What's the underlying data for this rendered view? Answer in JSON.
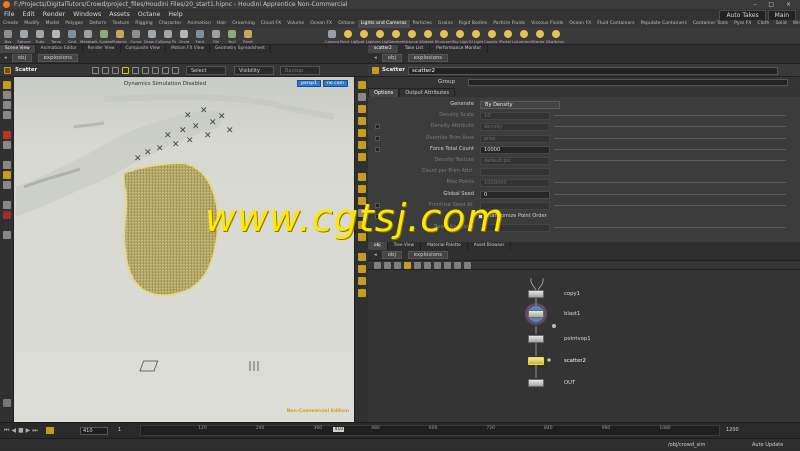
{
  "window": {
    "title": "F:/Projects/DigitalTutors/Crowd/project_files/Houdini Files/20_start1.hipnc - Houdini Apprentice Non-Commercial",
    "controls": "– □ ×"
  },
  "menu": {
    "items": [
      "File",
      "Edit",
      "Render",
      "Windows",
      "Assets",
      "Octane",
      "Help"
    ],
    "desktop": "Auto Takes",
    "desktop_value": "Main"
  },
  "shelf_tabs": [
    "Create",
    "Modify",
    "Model",
    "Polygon",
    "Deform",
    "Texture",
    "Rigging",
    "Character",
    "Animation",
    "Hair",
    "Grooming",
    "Cloud FX",
    "Volume",
    "Ocean FX",
    "Octane",
    "Lights and Cameras",
    "Particles",
    "Grains",
    "Rigid Bodies",
    "Particle Fluids",
    "Viscous Fluids",
    "Ocean FX",
    "Fluid Containers",
    "Populate Containers",
    "Container Tools",
    "Pyro FX",
    "Cloth",
    "Solid",
    "Wires",
    "Crowds",
    "Drive Simulation"
  ],
  "shelf_tools_left": [
    "Box",
    "Sphere",
    "Tube",
    "Torus",
    "Grid",
    "Metaball",
    "L-System",
    "Platonic Sol.",
    "Curve",
    "Draw Curve",
    "Spray Paint",
    "Circle",
    "Font",
    "File",
    "Null",
    "Rivet"
  ],
  "shelf_tools_right": [
    "Camera",
    "Point Light",
    "Spot Light",
    "Area Light",
    "Geometry L.",
    "Volume Light",
    "Distant Light",
    "Environmen.",
    "Sky Light",
    "GI Light",
    "Caustic Light",
    "Portal Light",
    "Ambient Lig.",
    "Stereo Cam.",
    "Switcher"
  ],
  "viewport_tabs": [
    "Scene View",
    "Animation Editor",
    "Render View",
    "Composite View",
    "Motion FX View",
    "Geometry Spreadsheet"
  ],
  "viewport": {
    "path_root": "obj",
    "path_node": "explosions",
    "operation": "Scatter",
    "select_label": "Select",
    "visibility_label": "Visibility",
    "backup_label": "Backup",
    "sim_status": "Dynamics Simulation Disabled",
    "camera": "persp1",
    "cam_mode": "no cam",
    "license": "Non-Commercial Edition"
  },
  "props_tabs": [
    "scatter2",
    "Take List",
    "Performance Monitor"
  ],
  "props": {
    "path_root": "obj",
    "path_node": "explosions",
    "node_type": "Scatter",
    "node_name": "scatter2",
    "group_label": "Group",
    "subtabs": [
      "Options",
      "Output Attributes"
    ],
    "params": [
      {
        "label": "Generate",
        "value": "By Density",
        "kind": "dropdown",
        "enabled": true,
        "checkbox": false
      },
      {
        "label": "Density Scale",
        "value": "10",
        "kind": "field",
        "enabled": false,
        "checkbox": false
      },
      {
        "label": "Density Attribute",
        "value": "density",
        "kind": "field",
        "enabled": false,
        "checkbox": true
      },
      {
        "label": "Override Prim Area",
        "value": "area",
        "kind": "field",
        "enabled": false,
        "checkbox": true
      },
      {
        "label": "Force Total Count",
        "value": "10000",
        "kind": "field",
        "enabled": true,
        "checkbox": true
      },
      {
        "label": "Density Texture",
        "value": "default.pic",
        "kind": "field",
        "enabled": false,
        "checkbox": false
      },
      {
        "label": "Count per Prim Attri.",
        "value": "",
        "kind": "field",
        "enabled": false,
        "checkbox": false
      },
      {
        "label": "Max Points",
        "value": "1000000",
        "kind": "field",
        "enabled": false,
        "checkbox": false
      },
      {
        "label": "Global Seed",
        "value": "0",
        "kind": "field",
        "enabled": true,
        "checkbox": false
      },
      {
        "label": "Primitive Seed At.",
        "value": "",
        "kind": "field",
        "enabled": false,
        "checkbox": true
      },
      {
        "label": "Randomize Point Order",
        "value": "",
        "kind": "toggle",
        "enabled": true,
        "checkbox": true
      },
      {
        "label": "Relax Iterations",
        "value": "",
        "kind": "field",
        "enabled": false,
        "checkbox": false
      }
    ]
  },
  "net_tabs": [
    "obj",
    "Tree View",
    "Material Palette",
    "Asset Browser"
  ],
  "network": {
    "path_root": "obj",
    "path_node": "explosions",
    "nodes": [
      {
        "name": "copy1",
        "selected": false
      },
      {
        "name": "blast1",
        "selected": false
      },
      {
        "name": "pointvop1",
        "selected": false
      },
      {
        "name": "scatter2",
        "selected": true
      },
      {
        "name": "OUT",
        "selected": false
      }
    ]
  },
  "timeline": {
    "frame": "410",
    "start": "1",
    "end": "1200",
    "ticks": [
      "120",
      "240",
      "360",
      "480",
      "600",
      "720",
      "840",
      "960",
      "1080"
    ],
    "current_tick": "410"
  },
  "status": {
    "path": "/obj/crowd_sim",
    "auto_update": "Auto Update"
  },
  "watermark": "www.cgtsj.com"
}
